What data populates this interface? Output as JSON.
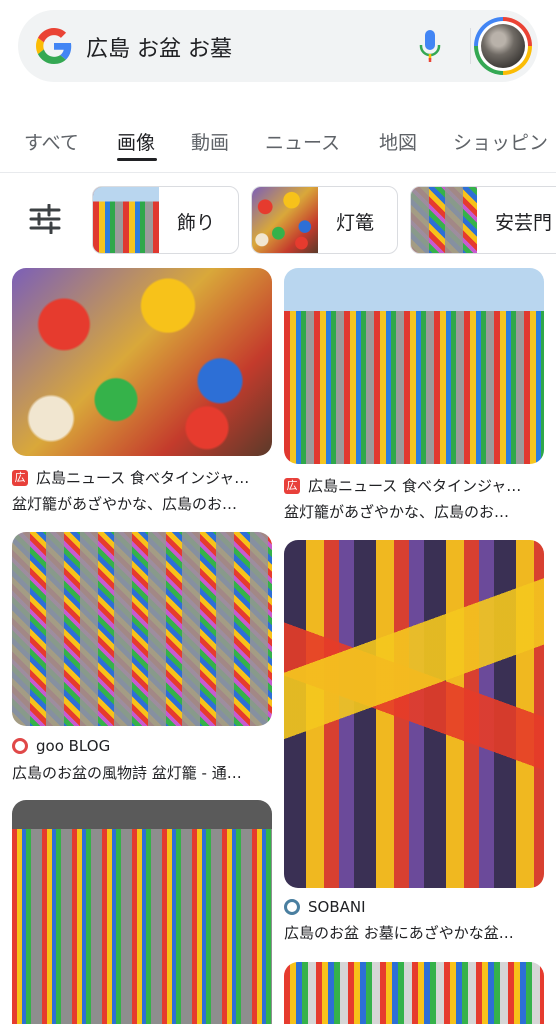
{
  "search": {
    "query": "広島 お盆 お墓"
  },
  "tabs": [
    {
      "label": "すべて"
    },
    {
      "label": "画像"
    },
    {
      "label": "動画"
    },
    {
      "label": "ニュース"
    },
    {
      "label": "地図"
    },
    {
      "label": "ショッピン"
    }
  ],
  "chips": [
    {
      "label": "飾り"
    },
    {
      "label": "灯篭"
    },
    {
      "label": "安芸門"
    }
  ],
  "results": [
    {
      "source": "広島ニュース 食べタインジャ…",
      "title": "盆灯籠があざやかな、広島のお…",
      "favicon": "広"
    },
    {
      "source": "広島ニュース 食べタインジャ…",
      "title": "盆灯籠があざやかな、広島のお…",
      "favicon": "広"
    },
    {
      "source": "goo BLOG",
      "title": "広島のお盆の風物詩 盆灯籠 - 通…"
    },
    {
      "source": "SOBANI",
      "title": "広島のお盆 お墓にあざやかな盆…"
    }
  ],
  "icons": {
    "google_logo": "google-g-icon",
    "mic": "mic-icon",
    "filter": "filter-sliders-icon",
    "avatar": "account-avatar"
  },
  "colors": {
    "google_blue": "#4285f4",
    "google_red": "#ea4335",
    "google_yellow": "#fbbc05",
    "google_green": "#34a853"
  }
}
